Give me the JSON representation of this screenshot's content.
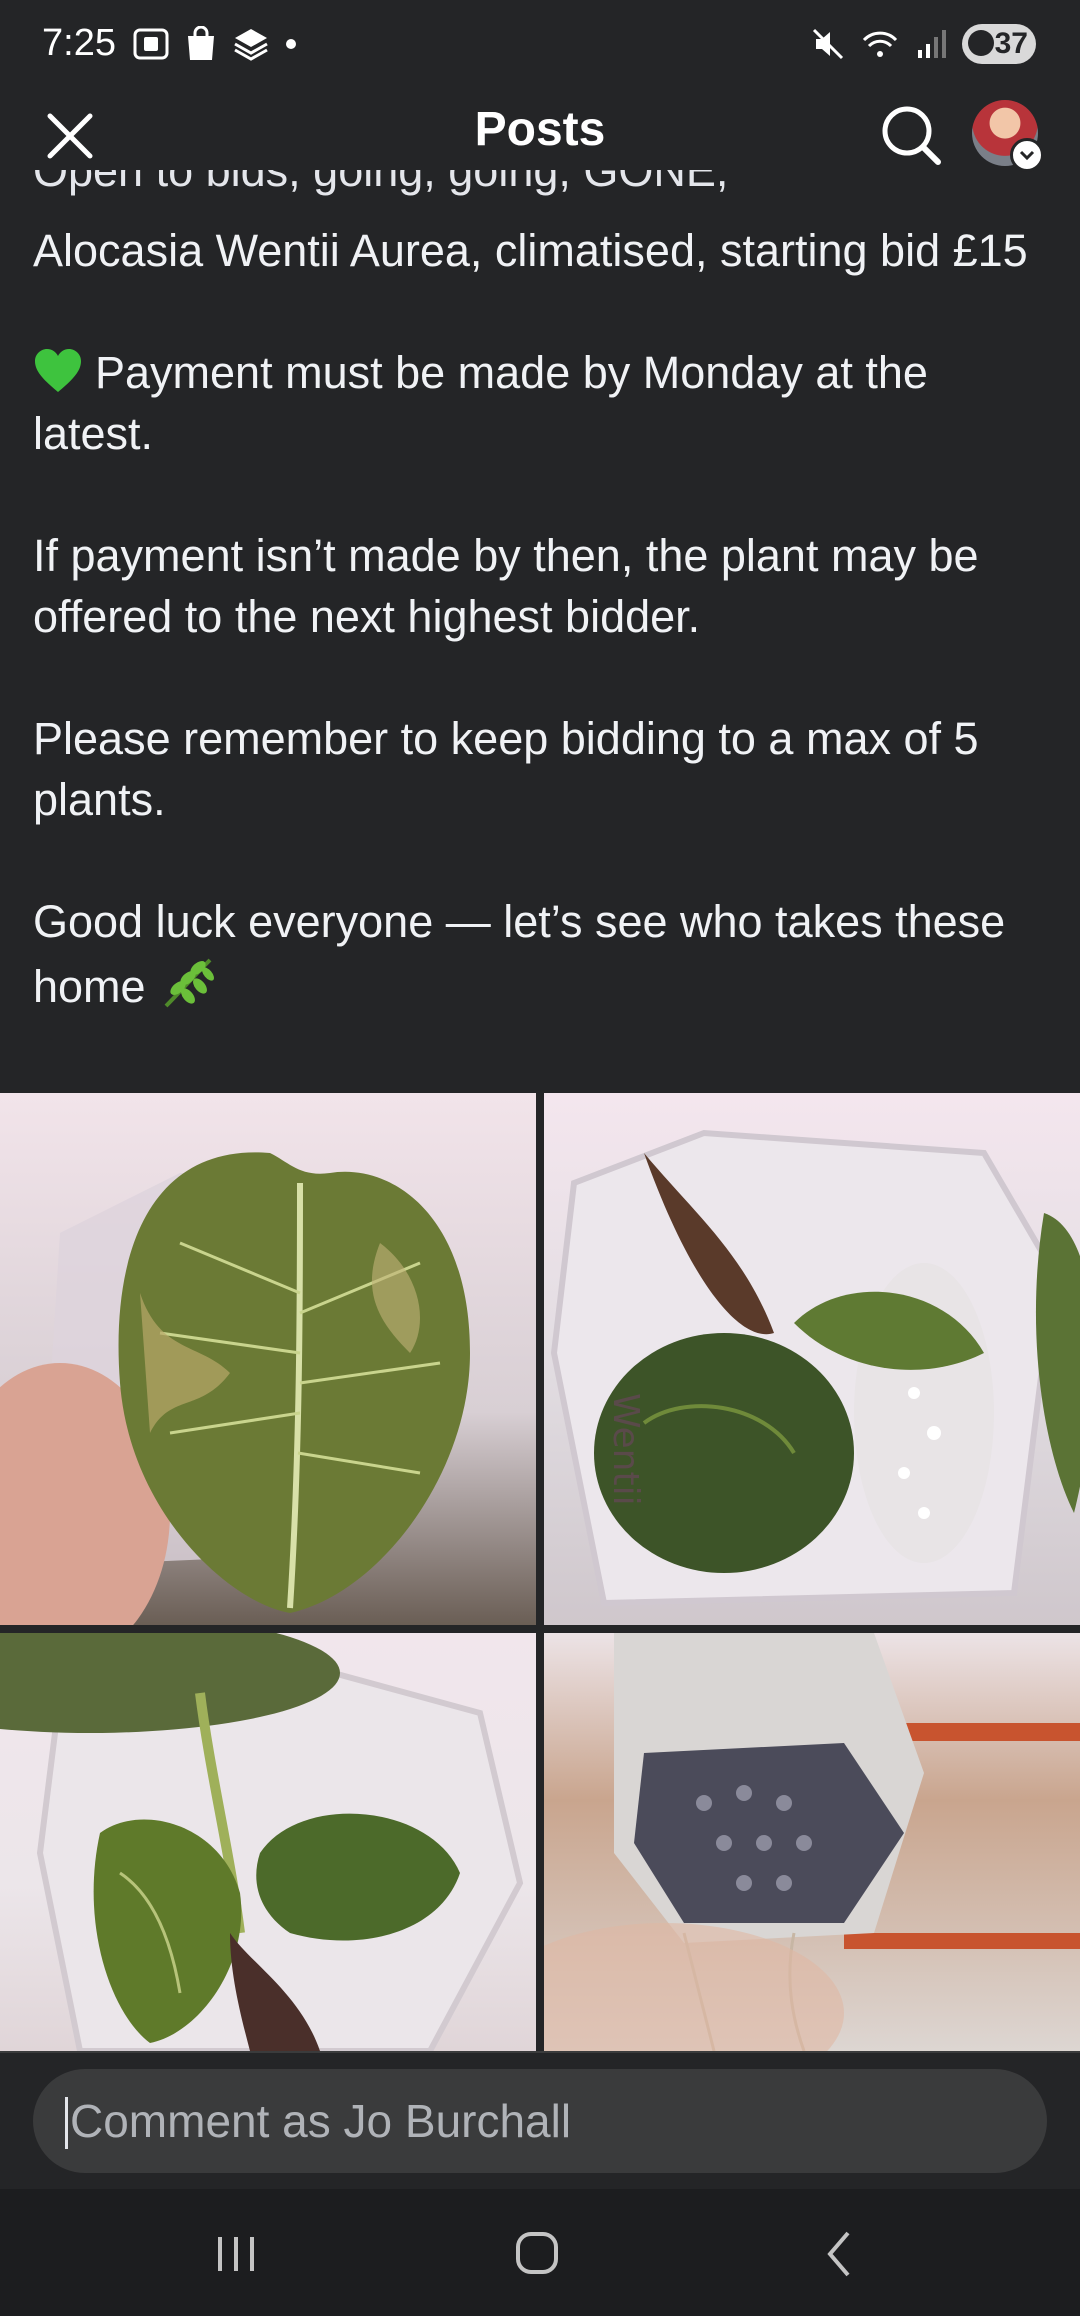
{
  "status_bar": {
    "time": "7:25",
    "battery": "37",
    "icons": [
      "screenshot-icon",
      "shopping-bag-icon",
      "layers-icon",
      "dot-icon",
      "mute-icon",
      "wifi-icon",
      "signal-icon",
      "battery-icon"
    ]
  },
  "header": {
    "title": "Posts",
    "icons": [
      "close-icon",
      "search-icon",
      "avatar"
    ]
  },
  "post": {
    "clipped_first_line": "Open to bids, going, going, GONE,",
    "line_item": "Alocasia Wentii Aurea, climatised, starting bid £15",
    "payment_deadline": "Payment must be made by Monday at the latest.",
    "payment_warning": "If payment isn’t made by then, the plant may be offered to the next highest bidder.",
    "bid_limit": "Please remember to keep bidding to a max of 5 plants.",
    "good_luck": "Good luck everyone — let’s see who takes these home"
  },
  "photos": [
    {
      "subject": "variegated alocasia leaf held in hand"
    },
    {
      "subject": "small alocasia plant in clear pot labelled"
    },
    {
      "subject": "alocasia plant with several leaves in clear pot"
    },
    {
      "subject": "root ball from underside of clear pot"
    }
  ],
  "comment": {
    "placeholder": "Comment as Jo Burchall"
  },
  "nav": {
    "icons": [
      "recents-icon",
      "home-icon",
      "back-icon"
    ]
  },
  "colors": {
    "background": "#242527",
    "text": "#f0f2f5",
    "input_bg": "#3a3b3c",
    "heart": "#3ec33e"
  }
}
